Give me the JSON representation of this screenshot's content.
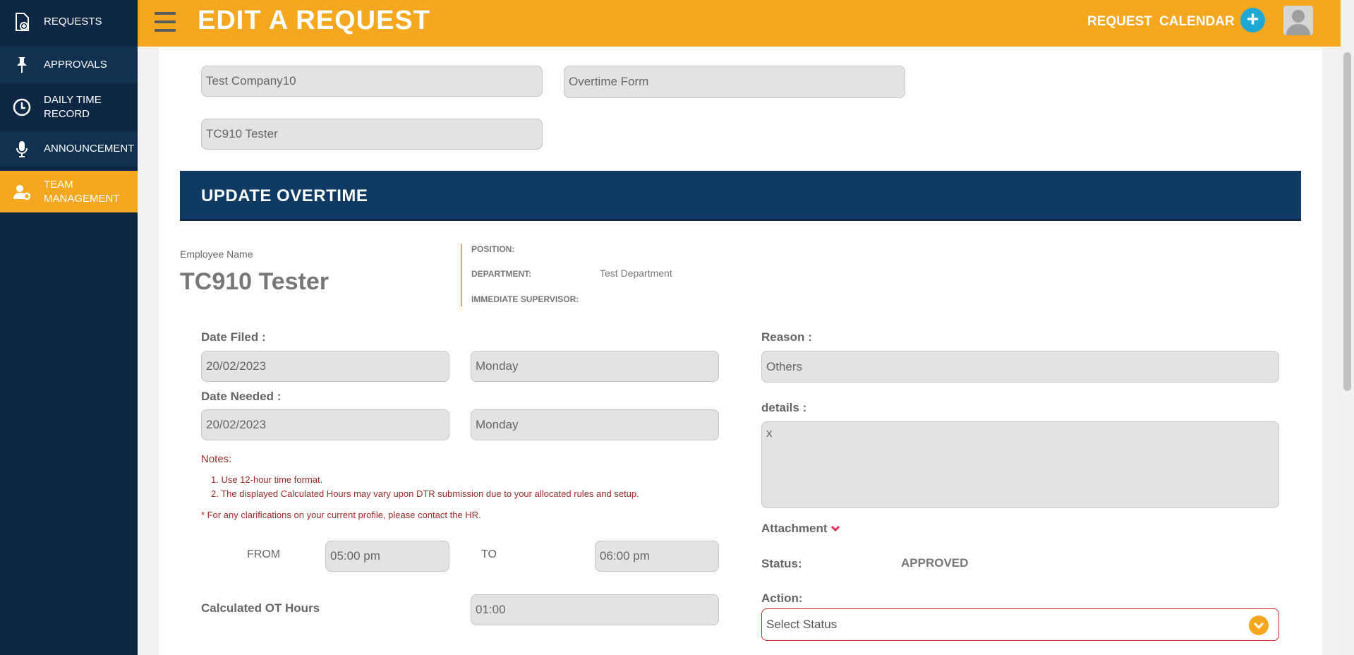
{
  "sidebar": {
    "items": [
      {
        "label": "REQUESTS",
        "icon": "file-plus-icon"
      },
      {
        "label": "APPROVALS",
        "icon": "pin-icon"
      },
      {
        "label": "DAILY TIME\nRECORD",
        "icon": "clock-icon"
      },
      {
        "label": "ANNOUNCEMENT",
        "icon": "microphone-icon"
      },
      {
        "label": "TEAM\nMANAGEMENT",
        "icon": "user-gear-icon"
      }
    ]
  },
  "header": {
    "title": "EDIT A REQUEST",
    "links": [
      "REQUEST",
      "CALENDAR"
    ],
    "plus": "+"
  },
  "form": {
    "company": "Test Company10",
    "form_type": "Overtime Form",
    "employee": "TC910 Tester",
    "section_title": "UPDATE OVERTIME",
    "employee_name_label": "Employee Name",
    "employee_name": "TC910 Tester",
    "position_label": "POSITION:",
    "position": "",
    "department_label": "DEPARTMENT:",
    "department": "Test Department",
    "supervisor_label": "IMMEDIATE SUPERVISOR:",
    "supervisor": "",
    "date_filed_label": "Date Filed :",
    "date_filed": "20/02/2023",
    "date_filed_day": "Monday",
    "date_needed_label": "Date Needed :",
    "date_needed": "20/02/2023",
    "date_needed_day": "Monday",
    "notes_label": "Notes:",
    "note1": "1. Use 12-hour time format.",
    "note2": "2. The displayed Calculated Hours may vary upon DTR submission due to your allocated rules and setup.",
    "note3": "* For any clarifications on your current profile, please contact the HR.",
    "from_label": "FROM",
    "from_time": "05:00 pm",
    "to_label": "TO",
    "to_time": "06:00 pm",
    "calc_label": "Calculated OT Hours",
    "calc_value": "01:00",
    "reason_label": "Reason :",
    "reason": "Others",
    "details_label": "details :",
    "details": "x",
    "attachment_label": "Attachment",
    "status_label": "Status:",
    "status": "APPROVED",
    "action_label": "Action:",
    "action_select": "Select Status"
  },
  "colors": {
    "accent": "#f5a81f",
    "sidebar": "#0d2744",
    "section": "#0e3a63",
    "note": "#9b2b2b"
  }
}
